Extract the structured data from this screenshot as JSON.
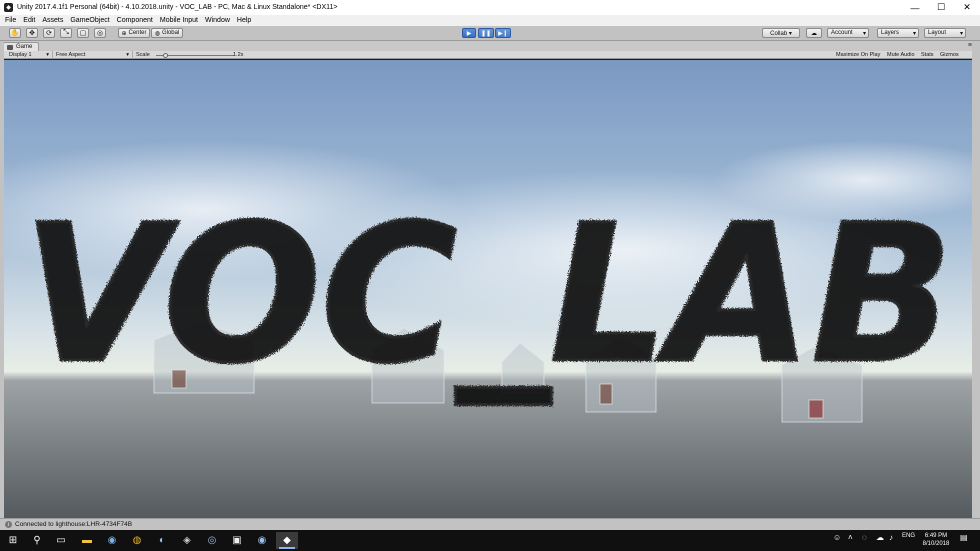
{
  "window": {
    "title": "Unity 2017.4.1f1 Personal (64bit) - 4.10.2018.unity - VOC_LAB - PC, Mac & Linux Standalone* <DX11>",
    "minimize": "—",
    "maximize": "☐",
    "close": "✕"
  },
  "menu": [
    "File",
    "Edit",
    "Assets",
    "GameObject",
    "Component",
    "Mobile Input",
    "Window",
    "Help"
  ],
  "toolbar": {
    "pivot_label": "Center",
    "space_label": "Global",
    "collab_label": "Collab ▾",
    "account_label": "Account",
    "layers_label": "Layers",
    "layout_label": "Layout"
  },
  "game_tab": {
    "label": "Game"
  },
  "game_bar": {
    "display": "Display 1",
    "aspect": "Free Aspect",
    "scale_label": "Scale",
    "scale_value": "1.2x",
    "maximize_on_play": "Maximize On Play",
    "mute_audio": "Mute Audio",
    "stats": "Stats",
    "gizmos": "Gizmos"
  },
  "scene": {
    "logo_text": "VOC_LAB"
  },
  "status": {
    "message": "Connected to lighthouse:LHR-4734F74B"
  },
  "taskbar": {
    "language": "ENG",
    "time": "6:49 PM",
    "date": "8/10/2018"
  },
  "colors": {
    "sky_top": "#7d9dc4",
    "sky_horizon": "#dfe7e9",
    "ground": "#5b6063",
    "play_blue": "#3a6fc0",
    "editor_gray": "#c2c2c2",
    "taskbar": "#101010"
  }
}
